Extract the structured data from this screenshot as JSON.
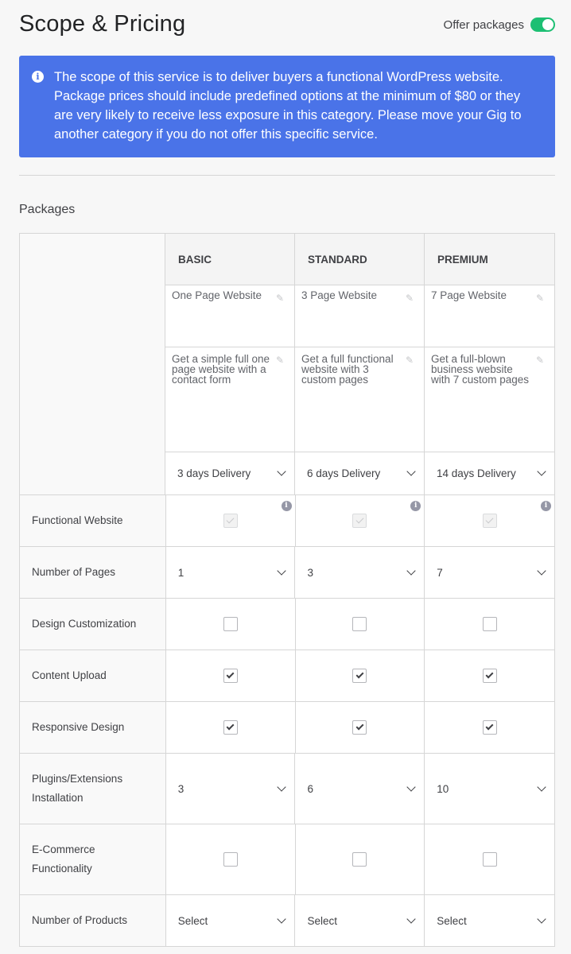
{
  "page": {
    "title": "Scope & Pricing",
    "offer_packages_label": "Offer packages",
    "offer_packages_enabled": true,
    "accent_color": "#1dbf73",
    "notice_color": "#4a73e8"
  },
  "notice": {
    "icon": "info-icon",
    "text": "The scope of this service is to deliver buyers a functional WordPress website. Package prices should include predefined options at the minimum of $80 or they are very likely to receive less exposure in this category. Please move your Gig to another category if you do not offer this specific service."
  },
  "packages": {
    "section_title": "Packages",
    "tiers": [
      {
        "name": "BASIC",
        "title": "One Page Website",
        "description": "Get a simple full one page website with a contact form",
        "delivery": "3 days Delivery"
      },
      {
        "name": "STANDARD",
        "title": "3 Page Website",
        "description": "Get a full functional website with 3 custom pages",
        "delivery": "6 days Delivery"
      },
      {
        "name": "PREMIUM",
        "title": "7 Page Website",
        "description": "Get a full-blown business website with 7 custom pages",
        "delivery": "14 days Delivery"
      }
    ],
    "features": [
      {
        "label": "Functional Website",
        "type": "checkbox",
        "disabled": true,
        "info": true,
        "values": [
          true,
          true,
          true
        ]
      },
      {
        "label": "Number of Pages",
        "type": "select",
        "values": [
          "1",
          "3",
          "7"
        ]
      },
      {
        "label": "Design Customization",
        "type": "checkbox",
        "values": [
          false,
          false,
          false
        ]
      },
      {
        "label": "Content Upload",
        "type": "checkbox",
        "values": [
          true,
          true,
          true
        ]
      },
      {
        "label": "Responsive Design",
        "type": "checkbox",
        "values": [
          true,
          true,
          true
        ]
      },
      {
        "label": "Plugins/Extensions Installation",
        "type": "select",
        "values": [
          "3",
          "6",
          "10"
        ]
      },
      {
        "label": "E-Commerce Functionality",
        "type": "checkbox",
        "values": [
          false,
          false,
          false
        ]
      },
      {
        "label": "Number of Products",
        "type": "select",
        "values": [
          "Select",
          "Select",
          "Select"
        ]
      }
    ]
  }
}
